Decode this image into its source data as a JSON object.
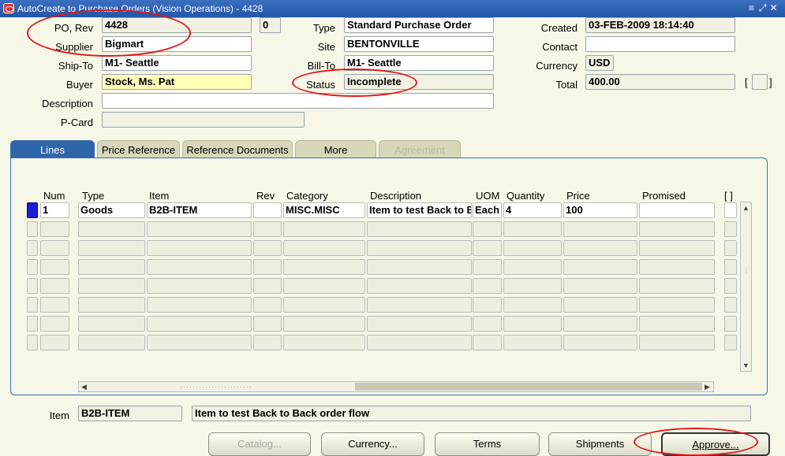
{
  "window": {
    "title": "AutoCreate to Purchase Orders (Vision Operations) - 4428",
    "controls": [
      "≡",
      "⤢",
      "✕"
    ]
  },
  "header": {
    "po_rev_label": "PO, Rev",
    "po_number": "4428",
    "revision": "0",
    "supplier_label": "Supplier",
    "supplier": "Bigmart",
    "ship_to_label": "Ship-To",
    "ship_to": "M1- Seattle",
    "buyer_label": "Buyer",
    "buyer": "Stock, Ms. Pat",
    "description_label": "Description",
    "description": "",
    "pcard_label": "P-Card",
    "pcard": "",
    "type_label": "Type",
    "type": "Standard Purchase Order",
    "site_label": "Site",
    "site": "BENTONVILLE",
    "bill_to_label": "Bill-To",
    "bill_to": "M1- Seattle",
    "status_label": "Status",
    "status": "Incomplete",
    "created_label": "Created",
    "created": "03-FEB-2009 18:14:40",
    "contact_label": "Contact",
    "contact": "",
    "currency_label": "Currency",
    "currency": "USD",
    "total_label": "Total",
    "total": "400.00",
    "bracket_left": "[",
    "bracket_right": "]"
  },
  "tabs": [
    {
      "label": "Lines",
      "state": "active"
    },
    {
      "label": "Price Reference",
      "state": "normal"
    },
    {
      "label": "Reference Documents",
      "state": "normal"
    },
    {
      "label": "More",
      "state": "normal"
    },
    {
      "label": "Agreement",
      "state": "disabled"
    }
  ],
  "lines": {
    "columns": [
      "Num",
      "Type",
      "Item",
      "Rev",
      "Category",
      "Description",
      "UOM",
      "Quantity",
      "Price",
      "Promised",
      "[ ]"
    ],
    "rows": [
      {
        "num": "1",
        "type": "Goods",
        "item": "B2B-ITEM",
        "rev": "",
        "category": "MISC.MISC",
        "description": "Item to test Back to B",
        "uom": "Each",
        "quantity": "4",
        "price": "100",
        "promised": ""
      }
    ]
  },
  "footer": {
    "item_label": "Item",
    "item": "B2B-ITEM",
    "item_description": "Item to test Back to Back order flow"
  },
  "buttons": {
    "catalog": "Catalog...",
    "currency": "Currency...",
    "terms": "Terms",
    "shipments": "Shipments",
    "approve": "Approve..."
  },
  "colors": {
    "title_bar": "#2456a8",
    "active_tab": "#2f66a9",
    "required_field": "#ffffb8",
    "annotation": "#e01818",
    "current_record": "#1d1dd8"
  }
}
